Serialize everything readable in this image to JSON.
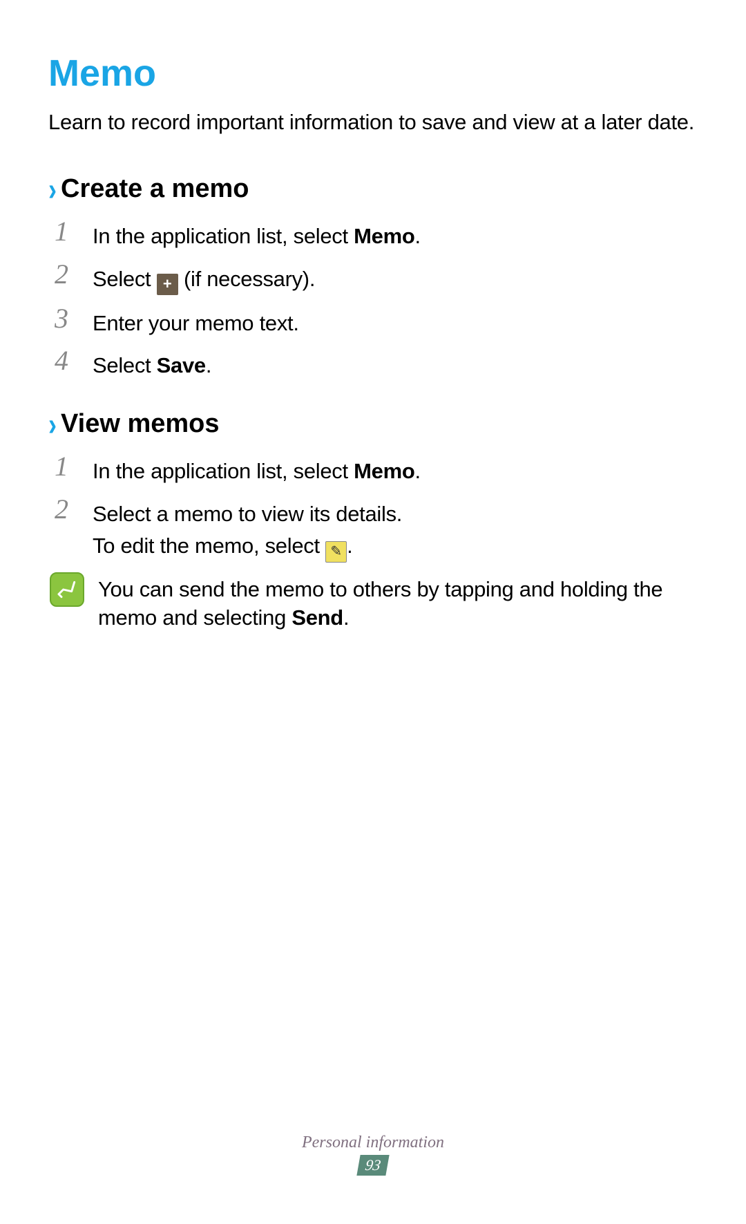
{
  "title": "Memo",
  "intro": "Learn to record important information to save and view at a later date.",
  "section_a": {
    "heading": "Create a memo",
    "steps": {
      "s1": {
        "num": "1",
        "pre": "In the application list, select ",
        "bold": "Memo",
        "post": "."
      },
      "s2": {
        "num": "2",
        "pre": "Select ",
        "post": " (if necessary)."
      },
      "s3": {
        "num": "3",
        "text": "Enter your memo text."
      },
      "s4": {
        "num": "4",
        "pre": "Select ",
        "bold": "Save",
        "post": "."
      }
    }
  },
  "section_b": {
    "heading": "View memos",
    "steps": {
      "s1": {
        "num": "1",
        "pre": "In the application list, select ",
        "bold": "Memo",
        "post": "."
      },
      "s2": {
        "num": "2",
        "line1": "Select a memo to view its details.",
        "line2_pre": "To edit the memo, select ",
        "line2_post": "."
      }
    },
    "note": {
      "pre": "You can send the memo to others by tapping and holding the memo and selecting ",
      "bold": "Send",
      "post": "."
    }
  },
  "footer": {
    "category": "Personal information",
    "page": "93"
  }
}
